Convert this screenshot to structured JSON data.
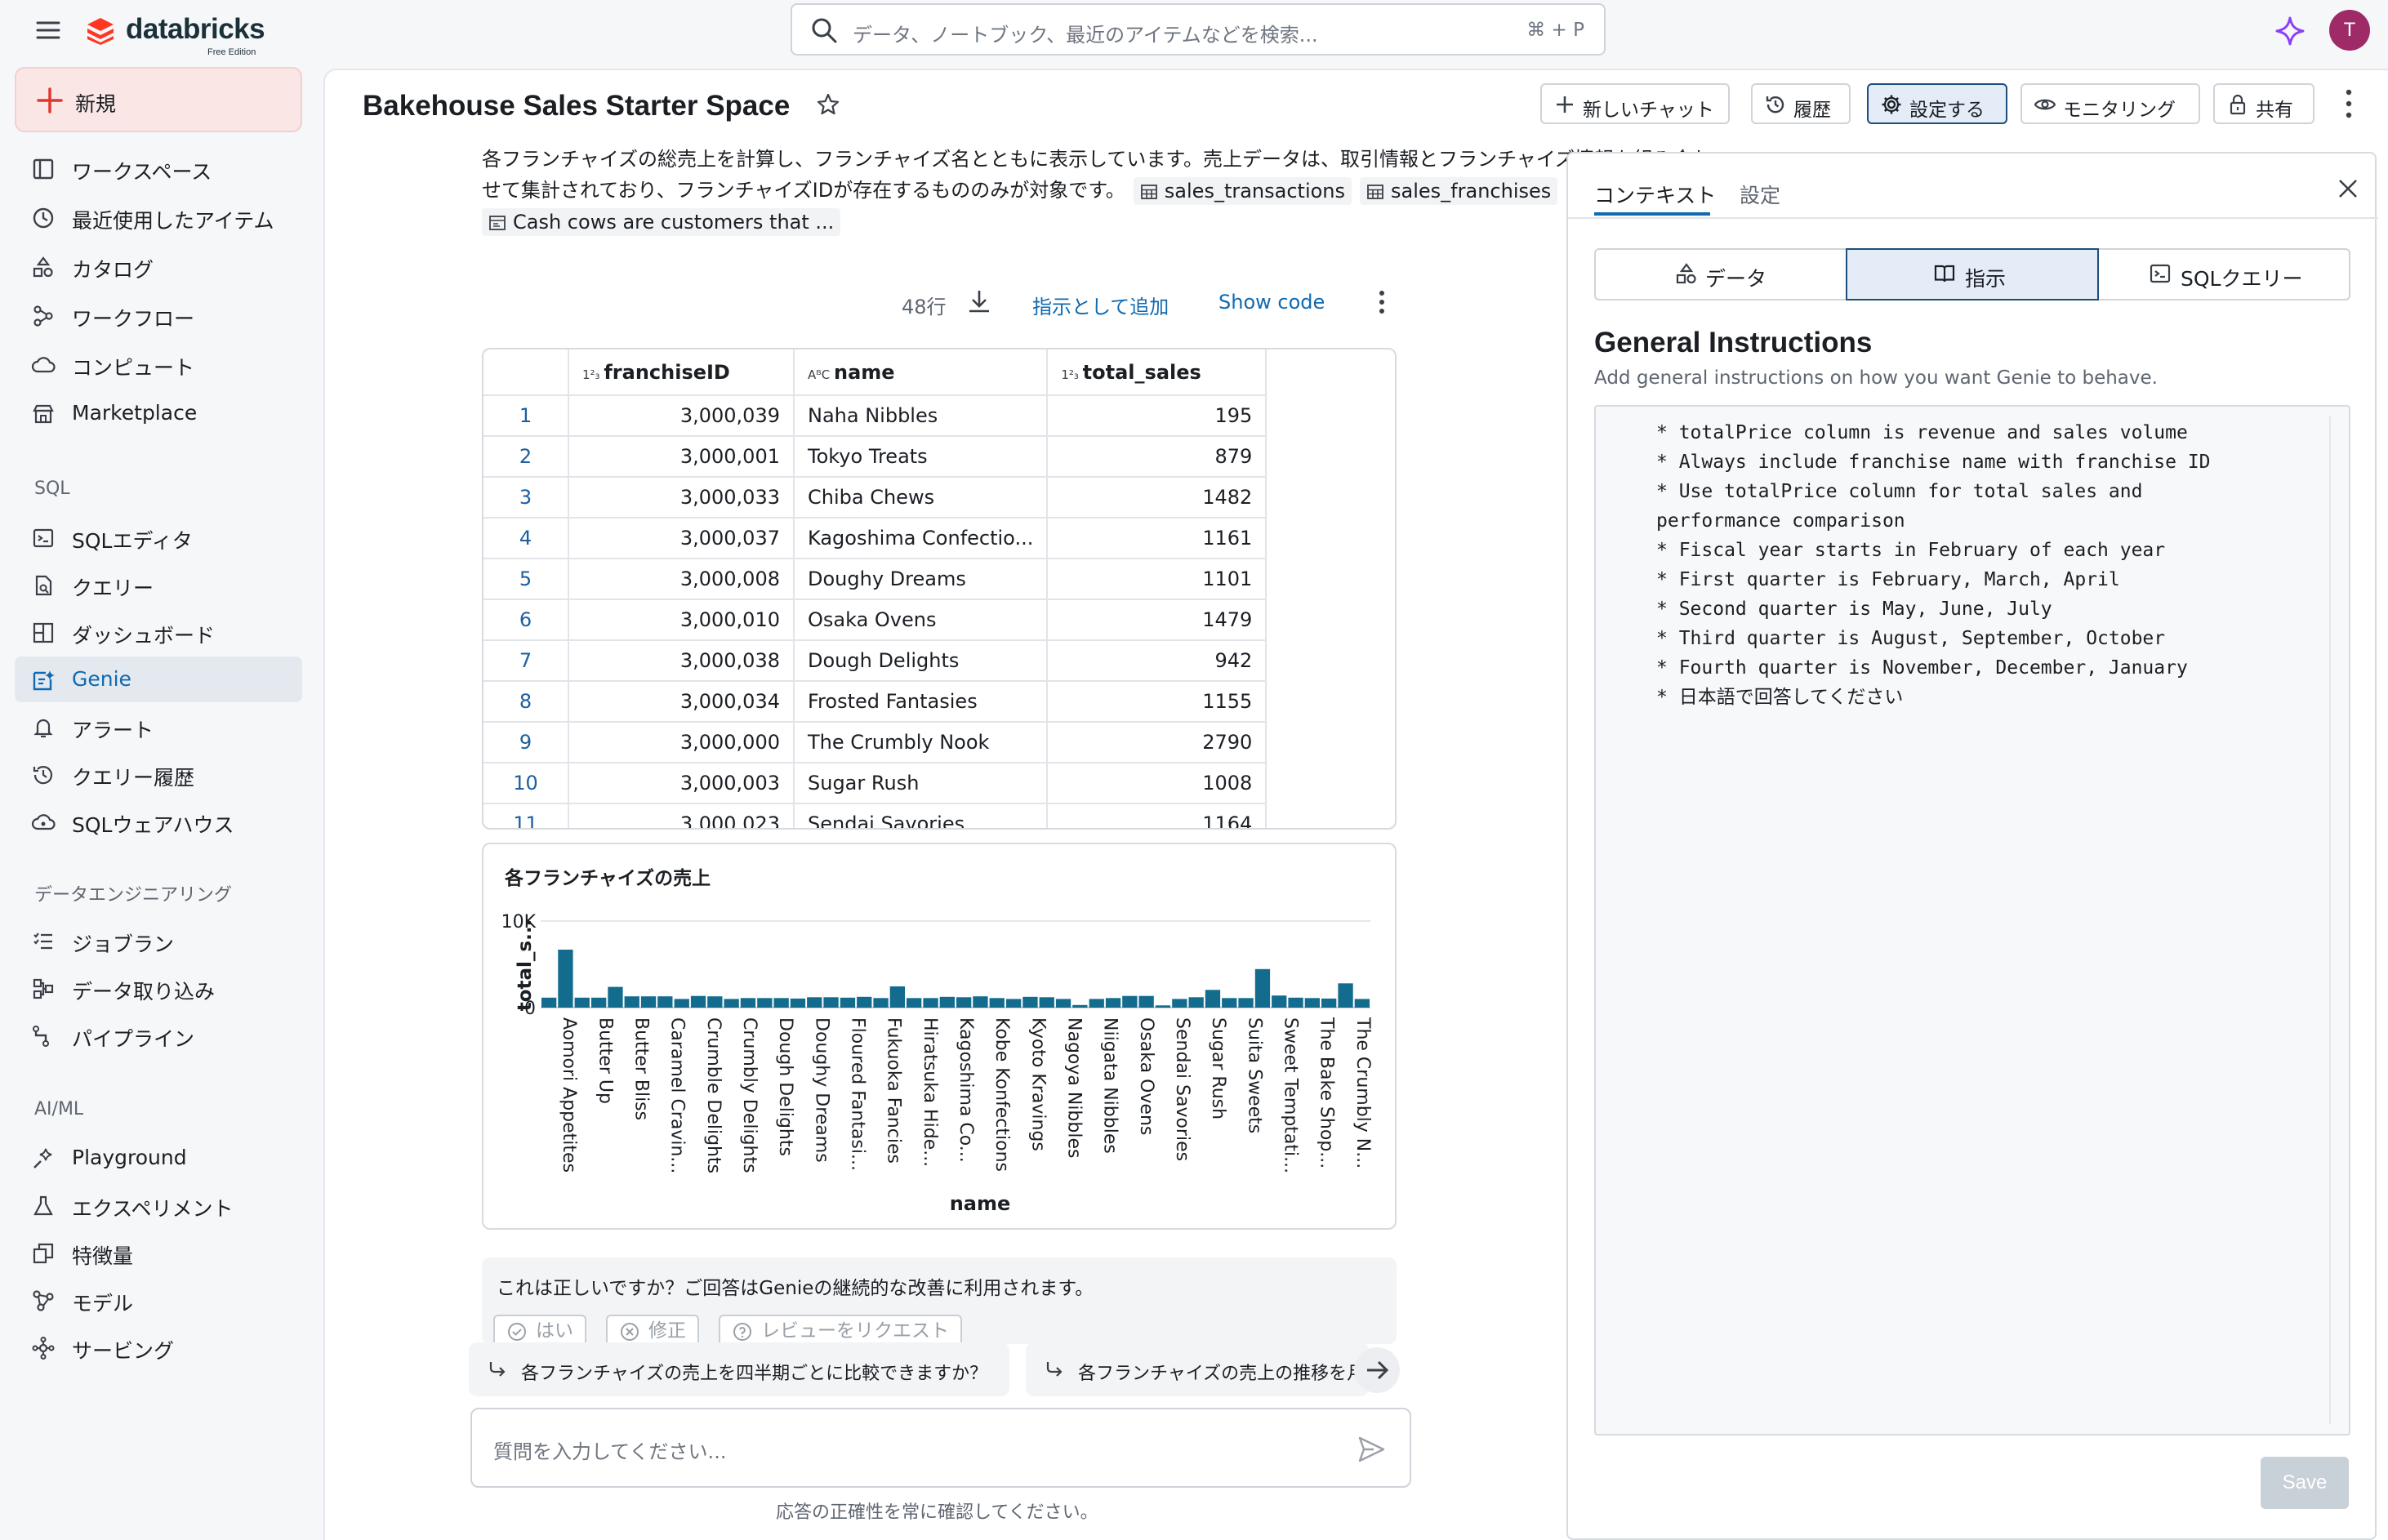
{
  "app": {
    "logo_name": "databricks",
    "logo_edition": "Free Edition",
    "avatar_letter": "T",
    "accent": "#0f6ab1",
    "brand": "#ff3621"
  },
  "search": {
    "placeholder": "データ、ノートブック、最近のアイテムなどを検索...",
    "shortcut": "⌘ + P"
  },
  "sidebar": {
    "new_label": "新規",
    "items": [
      {
        "label": "ワークスペース",
        "icon": "workspace-icon"
      },
      {
        "label": "最近使用したアイテム",
        "icon": "clock-icon"
      },
      {
        "label": "カタログ",
        "icon": "catalog-icon"
      },
      {
        "label": "ワークフロー",
        "icon": "workflow-icon"
      },
      {
        "label": "コンピュート",
        "icon": "cloud-icon"
      },
      {
        "label": "Marketplace",
        "icon": "store-icon"
      }
    ],
    "sql_section": "SQL",
    "sql_items": [
      {
        "label": "SQLエディタ",
        "icon": "sql-editor-icon"
      },
      {
        "label": "クエリー",
        "icon": "query-icon"
      },
      {
        "label": "ダッシュボード",
        "icon": "dashboard-icon"
      },
      {
        "label": "Genie",
        "icon": "genie-icon",
        "active": true
      },
      {
        "label": "アラート",
        "icon": "bell-icon"
      },
      {
        "label": "クエリー履歴",
        "icon": "history-icon"
      },
      {
        "label": "SQLウェアハウス",
        "icon": "warehouse-icon"
      }
    ],
    "de_section": "データエンジニアリング",
    "de_items": [
      {
        "label": "ジョブラン",
        "icon": "job-runs-icon"
      },
      {
        "label": "データ取り込み",
        "icon": "ingest-icon"
      },
      {
        "label": "パイプライン",
        "icon": "pipeline-icon"
      }
    ],
    "ml_section": "AI/ML",
    "ml_items": [
      {
        "label": "Playground",
        "icon": "playground-icon"
      },
      {
        "label": "エクスペリメント",
        "icon": "flask-icon"
      },
      {
        "label": "特徴量",
        "icon": "feature-icon"
      },
      {
        "label": "モデル",
        "icon": "model-icon"
      },
      {
        "label": "サービング",
        "icon": "serving-icon"
      }
    ]
  },
  "header": {
    "title": "Bakehouse Sales Starter Space",
    "new_chat": "新しいチャット",
    "history": "履歴",
    "configure": "設定する",
    "monitoring": "モニタリング",
    "share": "共有"
  },
  "message": {
    "text": "各フランチャイズの総売上を計算し、フランチャイズ名とともに表示しています。売上データは、取引情報とフランチャイズ情報を組み合わせて集計されており、フランチャイズIDが存在するもののみが対象です。",
    "chip1": "sales_transactions",
    "chip2": "sales_franchises",
    "chip3": "Cash cows are customers that ...",
    "row_count": "48行",
    "add_instruction": "指示として追加",
    "show_code": "Show code"
  },
  "table": {
    "headers": [
      "franchiseID",
      "name",
      "total_sales"
    ],
    "rows": [
      [
        "1",
        "3,000,039",
        "Naha Nibbles",
        "195"
      ],
      [
        "2",
        "3,000,001",
        "Tokyo Treats",
        "879"
      ],
      [
        "3",
        "3,000,033",
        "Chiba Chews",
        "1482"
      ],
      [
        "4",
        "3,000,037",
        "Kagoshima Confectio...",
        "1161"
      ],
      [
        "5",
        "3,000,008",
        "Doughy Dreams",
        "1101"
      ],
      [
        "6",
        "3,000,010",
        "Osaka Ovens",
        "1479"
      ],
      [
        "7",
        "3,000,038",
        "Dough Delights",
        "942"
      ],
      [
        "8",
        "3,000,034",
        "Frosted Fantasies",
        "1155"
      ],
      [
        "9",
        "3,000,000",
        "The Crumbly Nook",
        "2790"
      ],
      [
        "10",
        "3,000,003",
        "Sugar Rush",
        "1008"
      ],
      [
        "11",
        "3,000,023",
        "Sendai Savories",
        "1164"
      ]
    ]
  },
  "chart_data": {
    "type": "bar",
    "title": "各フランチャイズの売上",
    "xlabel": "name",
    "ylabel": "total_s...",
    "yticks": [
      "0",
      "10K"
    ],
    "ylim": [
      0,
      10000
    ],
    "bar_color": "#136c8e",
    "grid": true,
    "tick_labels": [
      "Aomori Appetites",
      "Butter Up",
      "Butter Bliss",
      "Caramel Cravin...",
      "Crumble Delights",
      "Crumbly Delights",
      "Dough Delights",
      "Doughy Dreams",
      "Floured Fantasi...",
      "Fukuoka Fancies",
      "Hiratsuka Hide...",
      "Kagoshima Co...",
      "Kobe Konfections",
      "Kyoto Kravings",
      "Nagoya Nibbles",
      "Niigata Nibbles",
      "Osaka Ovens",
      "Sendai Savories",
      "Sugar Rush",
      "Suita Sweets",
      "Sweet Temptati...",
      "The Bake Shop...",
      "The Crumbly N..."
    ],
    "values": [
      1150,
      6700,
      1150,
      1150,
      2400,
      1300,
      1300,
      1300,
      1000,
      1350,
      1300,
      1000,
      1100,
      1100,
      1100,
      1050,
      1200,
      1200,
      1150,
      1250,
      1100,
      2450,
      1100,
      1100,
      1250,
      1200,
      1300,
      1100,
      1000,
      1250,
      1200,
      1000,
      300,
      1000,
      1100,
      1350,
      1350,
      250,
      1000,
      1200,
      2050,
      1100,
      1100,
      4450,
      1400,
      1150,
      1100,
      1050,
      2800,
      1000
    ],
    "legend": "none"
  },
  "feedback": {
    "question": "これは正しいですか？ご回答はGenieの継続的な改善に利用されます。",
    "yes": "はい",
    "fix": "修正",
    "review": "レビューをリクエスト"
  },
  "suggestions": [
    "各フランチャイズの売上を四半期ごとに比較できますか？",
    "各フランチャイズの売上の推移を月"
  ],
  "chat": {
    "placeholder": "質問を入力してください...",
    "disclaimer": "応答の正確性を常に確認してください。"
  },
  "panel": {
    "tab_context": "コンテキスト",
    "tab_settings": "設定",
    "seg_data": "データ",
    "seg_instructions": "指示",
    "seg_sql": "SQLクエリー",
    "title": "General Instructions",
    "description": "Add general instructions on how you want Genie to behave.",
    "instructions": "* totalPrice column is revenue and sales volume\n* Always include franchise name with franchise ID\n* Use totalPrice column for total sales and\nperformance comparison\n* Fiscal year starts in February of each year\n* First quarter is February, March, April\n* Second quarter is May, June, July\n* Third quarter is August, September, October\n* Fourth quarter is November, December, January\n* 日本語で回答してください",
    "save": "Save"
  }
}
